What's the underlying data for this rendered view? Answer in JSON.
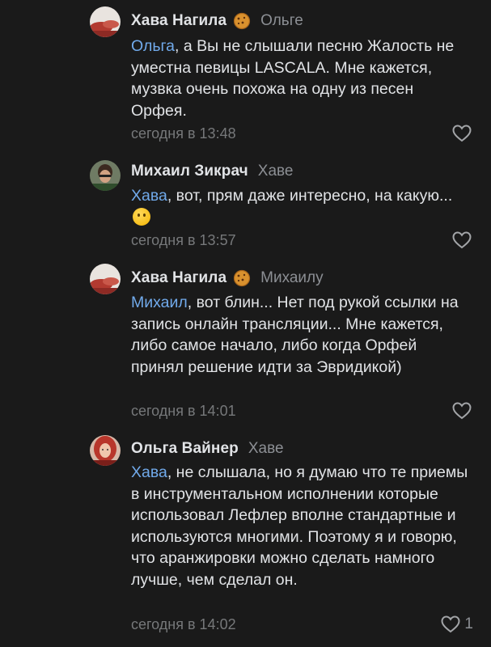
{
  "comments": [
    {
      "author": "Хава Нагила",
      "badge": "cookie-emoji",
      "reply_to": "Ольге",
      "mention": "Ольга",
      "text": ", а Вы не слышали песню Жалость не уместна певицы LASCALA. Мне кажется, музвка очень похожа на одну из песен Орфея.",
      "time": "сегодня в 13:48",
      "likes": ""
    },
    {
      "author": "Михаил Зикрач",
      "reply_to": "Хаве",
      "mention": "Хава",
      "text": ", вот, прям даже интересно, на какую...",
      "emoji": "thinking-face-emoji",
      "time": "сегодня в 13:57",
      "likes": ""
    },
    {
      "author": "Хава Нагила",
      "badge": "cookie-emoji",
      "reply_to": "Михаилу",
      "mention": "Михаил",
      "text": ", вот блин... Нет под рукой ссылки на запись онлайн трансляции... Мне кажется, либо самое начало, либо когда Орфей принял решение идти за Эвридикой)",
      "time": "сегодня в 14:01",
      "likes": ""
    },
    {
      "author": "Ольга Вайнер",
      "reply_to": "Хаве",
      "mention": "Хава",
      "text": ", не слышала, но я думаю что те приемы в инструментальном исполнении которые использовал Лефлер вполне стандартные и используются многими. Поэтому я и говорю, что аранжировки можно сделать намного лучше, чем сделал он.",
      "time": "сегодня в 14:02",
      "likes": "1"
    }
  ],
  "colors": {
    "background": "#1a1a1a",
    "mention": "#71aaeb",
    "text": "#e1e3e6",
    "secondary": "#76787a"
  }
}
